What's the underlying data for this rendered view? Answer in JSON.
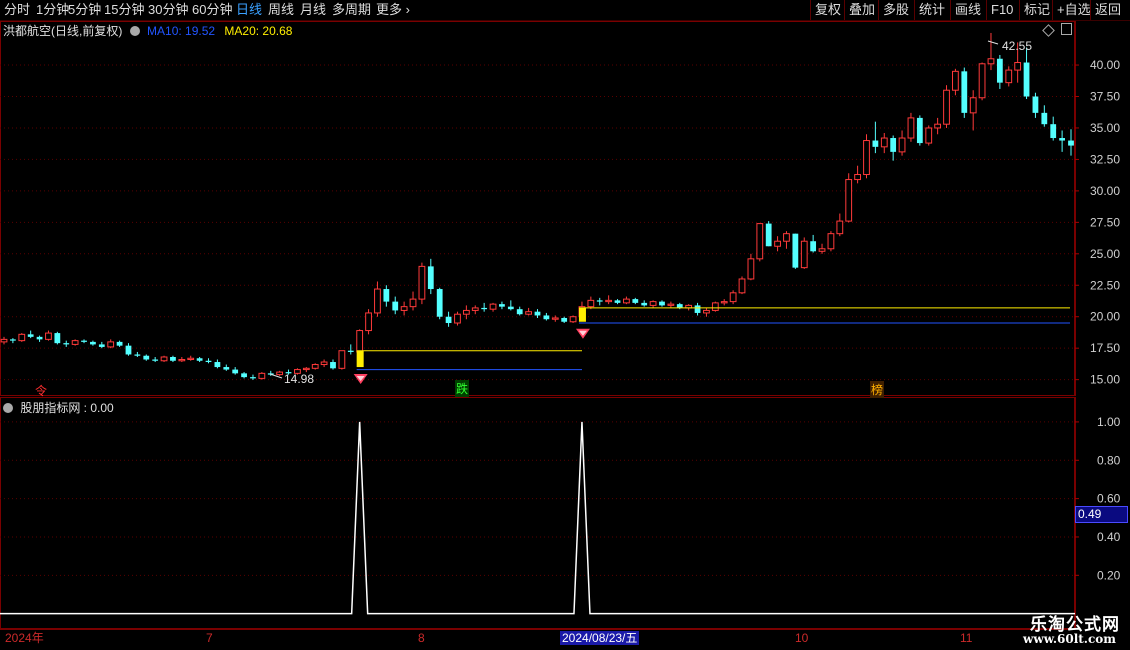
{
  "toolbar": {
    "left": [
      "分时",
      "1分钟",
      "5分钟",
      "15分钟",
      "30分钟",
      "60分钟",
      "日线",
      "周线",
      "月线",
      "多周期",
      "更多"
    ],
    "active": "日线",
    "right": [
      "复权",
      "叠加",
      "多股",
      "统计",
      "画线",
      "F10",
      "标记",
      "+自选",
      "返回"
    ]
  },
  "main_chart": {
    "stock_title": "洪都航空(日线,前复权)",
    "ma10_label": "MA10: 19.52",
    "ma20_label": "MA20: 20.68",
    "ma10_color": "#2255ff",
    "ma20_color": "#ffee00",
    "high_annotation": "42.55",
    "low_annotation": "14.98",
    "markers": [
      {
        "text": "令",
        "color": "#ff3030"
      },
      {
        "text": "跌",
        "color": "#30ff30"
      },
      {
        "text": "榜",
        "color": "#ffb000"
      }
    ]
  },
  "indicator": {
    "title": "股朋指标网 : 0.00",
    "value_box": "0.49"
  },
  "dates": {
    "labels": [
      "2024年",
      "7",
      "8",
      "10",
      "11"
    ],
    "selected": "2024/08/23/五"
  },
  "watermark": {
    "line1": "乐淘公式网",
    "line2": "www.60lt.com"
  },
  "chart_data": [
    {
      "type": "candlestick",
      "title": "洪都航空(日线,前复权)",
      "y_ticks": [
        15.0,
        17.5,
        20.0,
        22.5,
        25.0,
        27.5,
        30.0,
        32.5,
        35.0,
        37.5,
        40.0
      ],
      "ylim": [
        13.7,
        43.5
      ],
      "up_color": "#ff3a3a",
      "down_color": "#54ffff",
      "ohlc": [
        [
          18.0,
          18.4,
          17.8,
          18.2
        ],
        [
          18.2,
          18.3,
          17.9,
          18.1
        ],
        [
          18.1,
          18.7,
          18.0,
          18.6
        ],
        [
          18.6,
          18.9,
          18.3,
          18.4
        ],
        [
          18.4,
          18.5,
          18.0,
          18.2
        ],
        [
          18.2,
          18.9,
          18.1,
          18.7
        ],
        [
          18.7,
          18.8,
          17.8,
          17.9
        ],
        [
          17.9,
          18.1,
          17.6,
          17.8
        ],
        [
          17.8,
          18.2,
          17.7,
          18.1
        ],
        [
          18.1,
          18.2,
          17.9,
          18.0
        ],
        [
          18.0,
          18.1,
          17.7,
          17.8
        ],
        [
          17.8,
          18.0,
          17.5,
          17.6
        ],
        [
          17.6,
          18.2,
          17.5,
          18.0
        ],
        [
          18.0,
          18.1,
          17.6,
          17.7
        ],
        [
          17.7,
          17.9,
          16.9,
          17.0
        ],
        [
          17.0,
          17.2,
          16.8,
          16.9
        ],
        [
          16.9,
          17.0,
          16.5,
          16.6
        ],
        [
          16.6,
          16.8,
          16.4,
          16.5
        ],
        [
          16.5,
          16.9,
          16.4,
          16.8
        ],
        [
          16.8,
          16.9,
          16.4,
          16.5
        ],
        [
          16.5,
          16.8,
          16.4,
          16.6
        ],
        [
          16.6,
          16.9,
          16.5,
          16.7
        ],
        [
          16.7,
          16.8,
          16.4,
          16.5
        ],
        [
          16.5,
          16.7,
          16.3,
          16.4
        ],
        [
          16.4,
          16.6,
          15.9,
          16.0
        ],
        [
          16.0,
          16.2,
          15.7,
          15.8
        ],
        [
          15.8,
          16.0,
          15.4,
          15.5
        ],
        [
          15.5,
          15.6,
          15.1,
          15.2
        ],
        [
          15.2,
          15.4,
          14.98,
          15.1
        ],
        [
          15.1,
          15.6,
          15.0,
          15.5
        ],
        [
          15.5,
          15.7,
          15.3,
          15.4
        ],
        [
          15.4,
          15.7,
          15.3,
          15.6
        ],
        [
          15.6,
          15.8,
          15.4,
          15.5
        ],
        [
          15.5,
          15.9,
          15.4,
          15.8
        ],
        [
          15.8,
          16.0,
          15.6,
          15.9
        ],
        [
          15.9,
          16.3,
          15.8,
          16.2
        ],
        [
          16.2,
          16.6,
          16.0,
          16.4
        ],
        [
          16.4,
          16.6,
          15.8,
          15.9
        ],
        [
          15.9,
          17.3,
          15.8,
          17.3
        ],
        [
          17.3,
          17.8,
          17.0,
          17.2
        ],
        [
          17.2,
          19.0,
          17.1,
          18.9
        ],
        [
          18.9,
          20.6,
          18.6,
          20.3
        ],
        [
          20.3,
          22.8,
          20.0,
          22.2
        ],
        [
          22.2,
          22.5,
          20.8,
          21.2
        ],
        [
          21.2,
          21.6,
          20.2,
          20.5
        ],
        [
          20.5,
          21.2,
          20.1,
          20.8
        ],
        [
          20.8,
          22.0,
          20.5,
          21.4
        ],
        [
          21.4,
          24.3,
          21.0,
          24.0
        ],
        [
          24.0,
          24.6,
          21.8,
          22.2
        ],
        [
          22.2,
          22.3,
          19.8,
          20.0
        ],
        [
          20.0,
          20.4,
          19.2,
          19.5
        ],
        [
          19.5,
          20.4,
          19.3,
          20.2
        ],
        [
          20.2,
          20.9,
          19.8,
          20.5
        ],
        [
          20.5,
          20.9,
          20.2,
          20.7
        ],
        [
          20.7,
          21.1,
          20.4,
          20.6
        ],
        [
          20.6,
          21.1,
          20.4,
          21.0
        ],
        [
          21.0,
          21.2,
          20.6,
          20.8
        ],
        [
          20.8,
          21.3,
          20.5,
          20.6
        ],
        [
          20.6,
          20.8,
          20.1,
          20.2
        ],
        [
          20.2,
          20.7,
          20.1,
          20.4
        ],
        [
          20.4,
          20.6,
          19.9,
          20.1
        ],
        [
          20.1,
          20.3,
          19.7,
          19.8
        ],
        [
          19.8,
          20.1,
          19.6,
          19.9
        ],
        [
          19.9,
          20.0,
          19.5,
          19.6
        ],
        [
          19.6,
          20.1,
          19.5,
          20.0
        ],
        [
          20.0,
          21.2,
          19.9,
          20.8
        ],
        [
          20.8,
          21.6,
          20.6,
          21.3
        ],
        [
          21.3,
          21.5,
          20.9,
          21.2
        ],
        [
          21.2,
          21.7,
          21.0,
          21.3
        ],
        [
          21.3,
          21.4,
          21.0,
          21.1
        ],
        [
          21.1,
          21.6,
          21.0,
          21.4
        ],
        [
          21.4,
          21.5,
          21.0,
          21.1
        ],
        [
          21.1,
          21.3,
          20.8,
          20.9
        ],
        [
          20.9,
          21.3,
          20.7,
          21.2
        ],
        [
          21.2,
          21.3,
          20.8,
          20.9
        ],
        [
          20.9,
          21.2,
          20.7,
          21.0
        ],
        [
          21.0,
          21.1,
          20.6,
          20.7
        ],
        [
          20.7,
          21.0,
          20.5,
          20.9
        ],
        [
          20.9,
          21.1,
          20.1,
          20.3
        ],
        [
          20.3,
          20.7,
          20.0,
          20.5
        ],
        [
          20.5,
          21.2,
          20.4,
          21.1
        ],
        [
          21.1,
          21.4,
          20.9,
          21.2
        ],
        [
          21.2,
          22.1,
          21.0,
          21.9
        ],
        [
          21.9,
          23.2,
          21.8,
          23.0
        ],
        [
          23.0,
          25.0,
          22.9,
          24.6
        ],
        [
          24.6,
          27.4,
          24.4,
          27.4
        ],
        [
          27.4,
          27.6,
          25.6,
          25.6
        ],
        [
          25.6,
          26.4,
          25.2,
          26.0
        ],
        [
          26.0,
          26.8,
          25.4,
          26.6
        ],
        [
          26.6,
          26.6,
          23.8,
          23.9
        ],
        [
          23.9,
          26.3,
          23.8,
          26.0
        ],
        [
          26.0,
          26.5,
          25.1,
          25.2
        ],
        [
          25.2,
          25.8,
          25.0,
          25.4
        ],
        [
          25.4,
          26.8,
          25.2,
          26.6
        ],
        [
          26.6,
          28.2,
          26.4,
          27.6
        ],
        [
          27.6,
          31.4,
          27.5,
          30.9
        ],
        [
          30.9,
          32.0,
          30.6,
          31.3
        ],
        [
          31.3,
          34.5,
          31.0,
          34.0
        ],
        [
          34.0,
          35.5,
          33.0,
          33.5
        ],
        [
          33.5,
          34.6,
          33.0,
          34.2
        ],
        [
          34.2,
          34.4,
          32.4,
          33.1
        ],
        [
          33.1,
          34.8,
          32.8,
          34.2
        ],
        [
          34.2,
          36.2,
          33.9,
          35.8
        ],
        [
          35.8,
          36.0,
          33.6,
          33.8
        ],
        [
          33.8,
          35.2,
          33.6,
          35.0
        ],
        [
          35.0,
          35.8,
          34.5,
          35.3
        ],
        [
          35.3,
          38.4,
          35.0,
          38.0
        ],
        [
          38.0,
          39.7,
          37.6,
          39.5
        ],
        [
          39.5,
          39.8,
          35.8,
          36.2
        ],
        [
          36.2,
          38.0,
          34.8,
          37.4
        ],
        [
          37.4,
          40.2,
          37.2,
          40.1
        ],
        [
          40.1,
          42.55,
          39.6,
          40.5
        ],
        [
          40.5,
          40.8,
          38.1,
          38.6
        ],
        [
          38.6,
          39.9,
          38.3,
          39.6
        ],
        [
          39.6,
          41.8,
          38.6,
          40.2
        ],
        [
          40.2,
          41.4,
          37.3,
          37.5
        ],
        [
          37.5,
          37.8,
          35.8,
          36.2
        ],
        [
          36.2,
          36.8,
          35.1,
          35.3
        ],
        [
          35.3,
          35.9,
          34.0,
          34.2
        ],
        [
          34.2,
          34.8,
          33.1,
          34.0
        ],
        [
          34.0,
          34.9,
          32.8,
          33.6
        ]
      ],
      "ma10_line": [
        [
          0,
          15.8
        ],
        [
          0.46,
          15.8
        ],
        [
          0.46,
          19.5
        ],
        [
          1.0,
          19.5
        ]
      ],
      "ma20_line": [
        [
          0,
          17.3
        ],
        [
          0.46,
          17.3
        ],
        [
          0.46,
          20.7
        ],
        [
          1.0,
          20.7
        ]
      ]
    },
    {
      "type": "line",
      "title": "股朋指标网",
      "y_ticks": [
        0.2,
        0.4,
        0.6,
        0.8,
        1.0
      ],
      "ylim": [
        -0.08,
        1.13
      ],
      "spikes_at_index": [
        40,
        65
      ],
      "values_baseline": 0
    }
  ]
}
